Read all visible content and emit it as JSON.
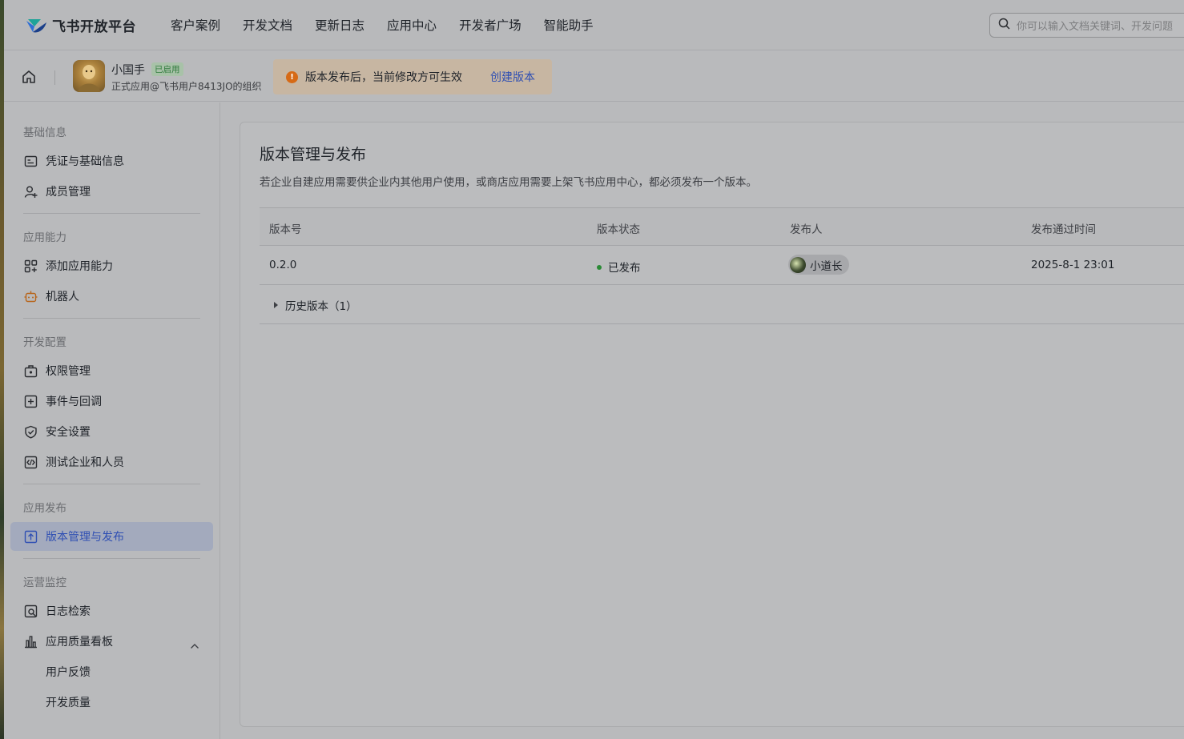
{
  "topnav": {
    "brand": "飞书开放平台",
    "links": [
      "客户案例",
      "开发文档",
      "更新日志",
      "应用中心",
      "开发者广场",
      "智能助手"
    ],
    "search_placeholder": "你可以输入文档关键词、开发问题"
  },
  "app_header": {
    "app_name": "小国手",
    "status": "已启用",
    "subtitle": "正式应用@飞书用户8413JO的组织",
    "notice_text": "版本发布后，当前修改方可生效",
    "notice_link": "创建版本"
  },
  "sidebar": {
    "sections": [
      {
        "title": "基础信息",
        "items": [
          {
            "label": "凭证与基础信息",
            "icon": "credential-icon"
          },
          {
            "label": "成员管理",
            "icon": "add-member-icon"
          }
        ]
      },
      {
        "title": "应用能力",
        "items": [
          {
            "label": "添加应用能力",
            "icon": "apps-add-icon"
          },
          {
            "label": "机器人",
            "icon": "robot-icon"
          }
        ]
      },
      {
        "title": "开发配置",
        "items": [
          {
            "label": "权限管理",
            "icon": "permission-icon"
          },
          {
            "label": "事件与回调",
            "icon": "event-icon"
          },
          {
            "label": "安全设置",
            "icon": "shield-icon"
          },
          {
            "label": "测试企业和人员",
            "icon": "code-icon"
          }
        ]
      },
      {
        "title": "应用发布",
        "items": [
          {
            "label": "版本管理与发布",
            "icon": "upload-icon",
            "active": true
          }
        ]
      },
      {
        "title": "运营监控",
        "items": [
          {
            "label": "日志检索",
            "icon": "log-search-icon"
          },
          {
            "label": "应用质量看板",
            "icon": "bar-chart-icon",
            "expanded": true
          },
          {
            "label": "用户反馈"
          },
          {
            "label": "开发质量"
          }
        ]
      }
    ]
  },
  "main": {
    "title": "版本管理与发布",
    "description": "若企业自建应用需要供企业内其他用户使用，或商店应用需要上架飞书应用中心，都必须发布一个版本。",
    "columns": [
      "版本号",
      "版本状态",
      "发布人",
      "发布通过时间"
    ],
    "rows": [
      {
        "version": "0.2.0",
        "status": "已发布",
        "publisher": "小道长",
        "time": "2025-8-1 23:01"
      }
    ],
    "history_label": "历史版本（1）"
  },
  "colors": {
    "accent": "#2f4fb3",
    "published": "#2a8a35",
    "warning": "#d66a16"
  }
}
